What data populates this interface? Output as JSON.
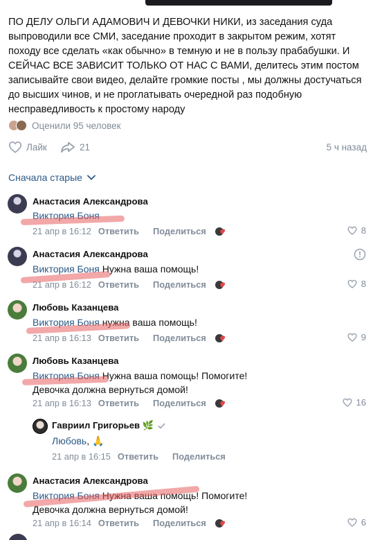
{
  "post": {
    "text": "ПО ДЕЛУ ОЛЬГИ АДАМОВИЧ И ДЕВОЧКИ НИКИ, из заседания суда выпроводили все СМИ, заседание проходит в закрытом режим, хотят походу все сделать «как обычно» в темную и не в пользу прабабушки. И СЕЙЧАС ВСЕ ЗАВИСИТ ТОЛЬКО ОТ НАС С ВАМИ, делитесь этим постом записывайте свои видео, делайте громкие посты , мы должны достучаться до высших чинов, и не проглатывать очередной раз подобную несправедливость к простому народу",
    "rated": "Оценили 95 человек",
    "like_label": "Лайк",
    "share_count": "21",
    "time": "5 ч назад"
  },
  "sort": {
    "label": "Сначала старые"
  },
  "comments": [
    {
      "author": "Анастасия Александрова",
      "mention": "Виктория Боня",
      "text": "",
      "line2": "",
      "date": "21 апр в 16:12",
      "reply": "Ответить",
      "share": "Поделиться",
      "likes": "8"
    },
    {
      "author": "Анастасия Александрова",
      "mention": "Виктория Боня",
      "text": " Нужна ваша помощь!",
      "line2": "",
      "date": "21 апр в 16:12",
      "reply": "Ответить",
      "share": "Поделиться",
      "likes": "8"
    },
    {
      "author": "Любовь Казанцева",
      "mention": "Виктория Боня",
      "text": " нужна ваша помощь!",
      "line2": "",
      "date": "21 апр в 16:13",
      "reply": "Ответить",
      "share": "Поделиться",
      "likes": "9"
    },
    {
      "author": "Любовь Казанцева",
      "mention": "Виктория Боня",
      "text": " Нужна ваша помощь! Помогите!",
      "line2": "Девочка должна вернуться домой!",
      "date": "21 апр в 16:13",
      "reply": "Ответить",
      "share": "Поделиться",
      "likes": "16"
    },
    {
      "author": "Гавриил Григорьев 🌿",
      "mention": "Любовь",
      "text": ", 🙏",
      "line2": "",
      "date": "21 апр в 16:15",
      "reply": "Ответить",
      "share": "Поделиться",
      "likes": ""
    },
    {
      "author": "Анастасия Александрова",
      "mention": "Виктория Боня",
      "text": " Нужна ваша помощь! Помогите!",
      "line2": "Девочка должна вернуться домой!",
      "date": "21 апр в 16:14",
      "reply": "Ответить",
      "share": "Поделиться",
      "likes": "6"
    }
  ],
  "colors": {
    "link": "#2a5885",
    "muted": "#818c99",
    "highlight": "#e86060"
  }
}
